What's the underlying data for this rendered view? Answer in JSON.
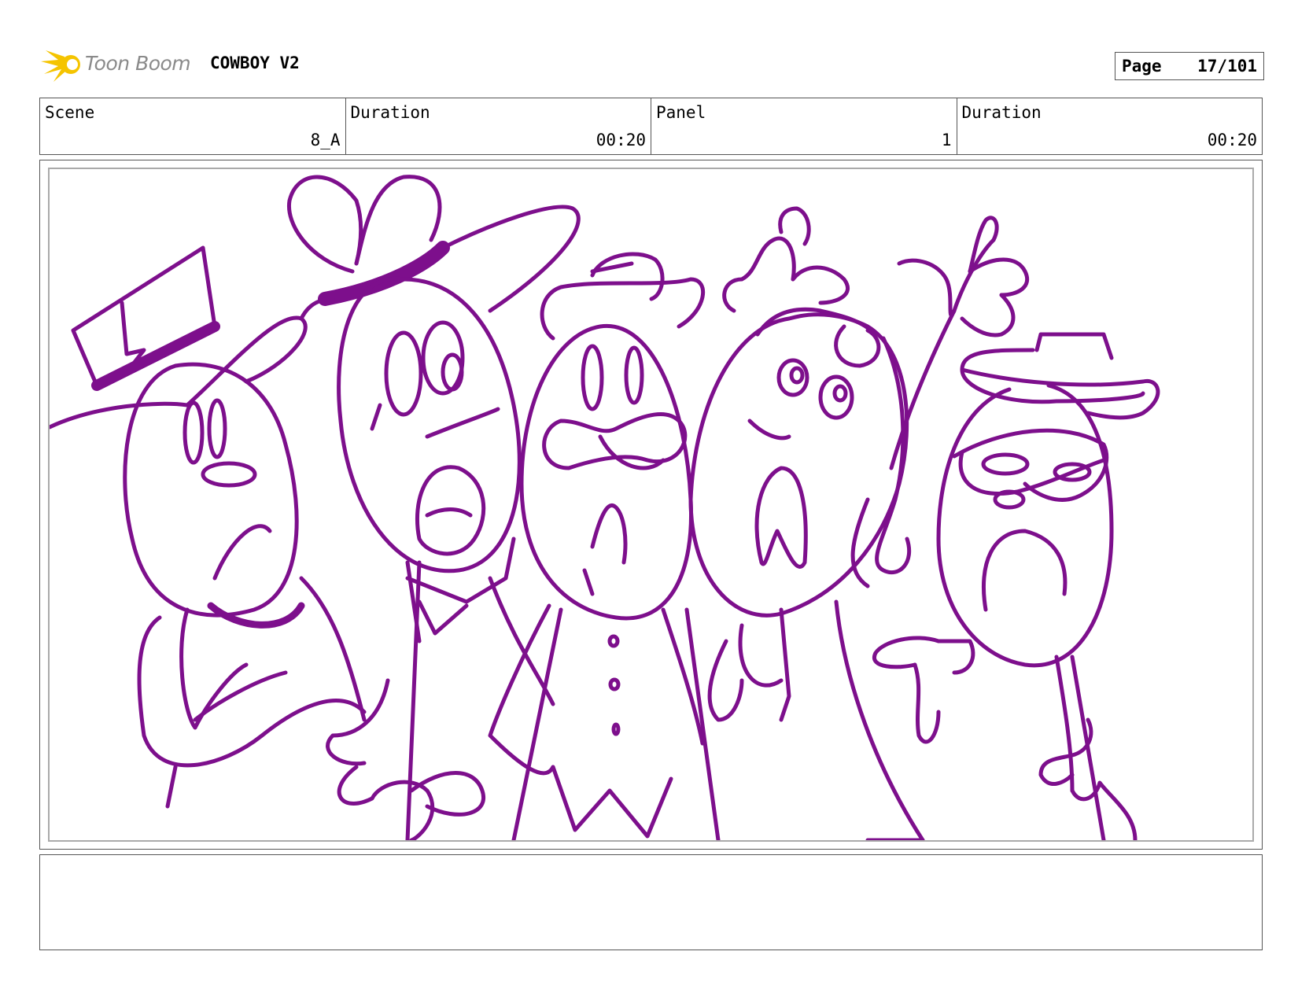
{
  "logo": {
    "name": "toon-boom-logo",
    "text": "Toon Boom",
    "color": "#f5c400"
  },
  "project": {
    "title": "COWBOY V2"
  },
  "page": {
    "label": "Page",
    "number": "17/101"
  },
  "info": {
    "scene_label": "Scene",
    "scene_value": "8_A",
    "scene_duration_label": "Duration",
    "scene_duration_value": "00:20",
    "panel_label": "Panel",
    "panel_value": "1",
    "panel_duration_label": "Duration",
    "panel_duration_value": "00:20"
  },
  "drawing": {
    "stroke_color": "#7d0f8c",
    "subject": "five cartoon egg-shaped characters in hats, singing"
  },
  "notes": {
    "text": ""
  }
}
